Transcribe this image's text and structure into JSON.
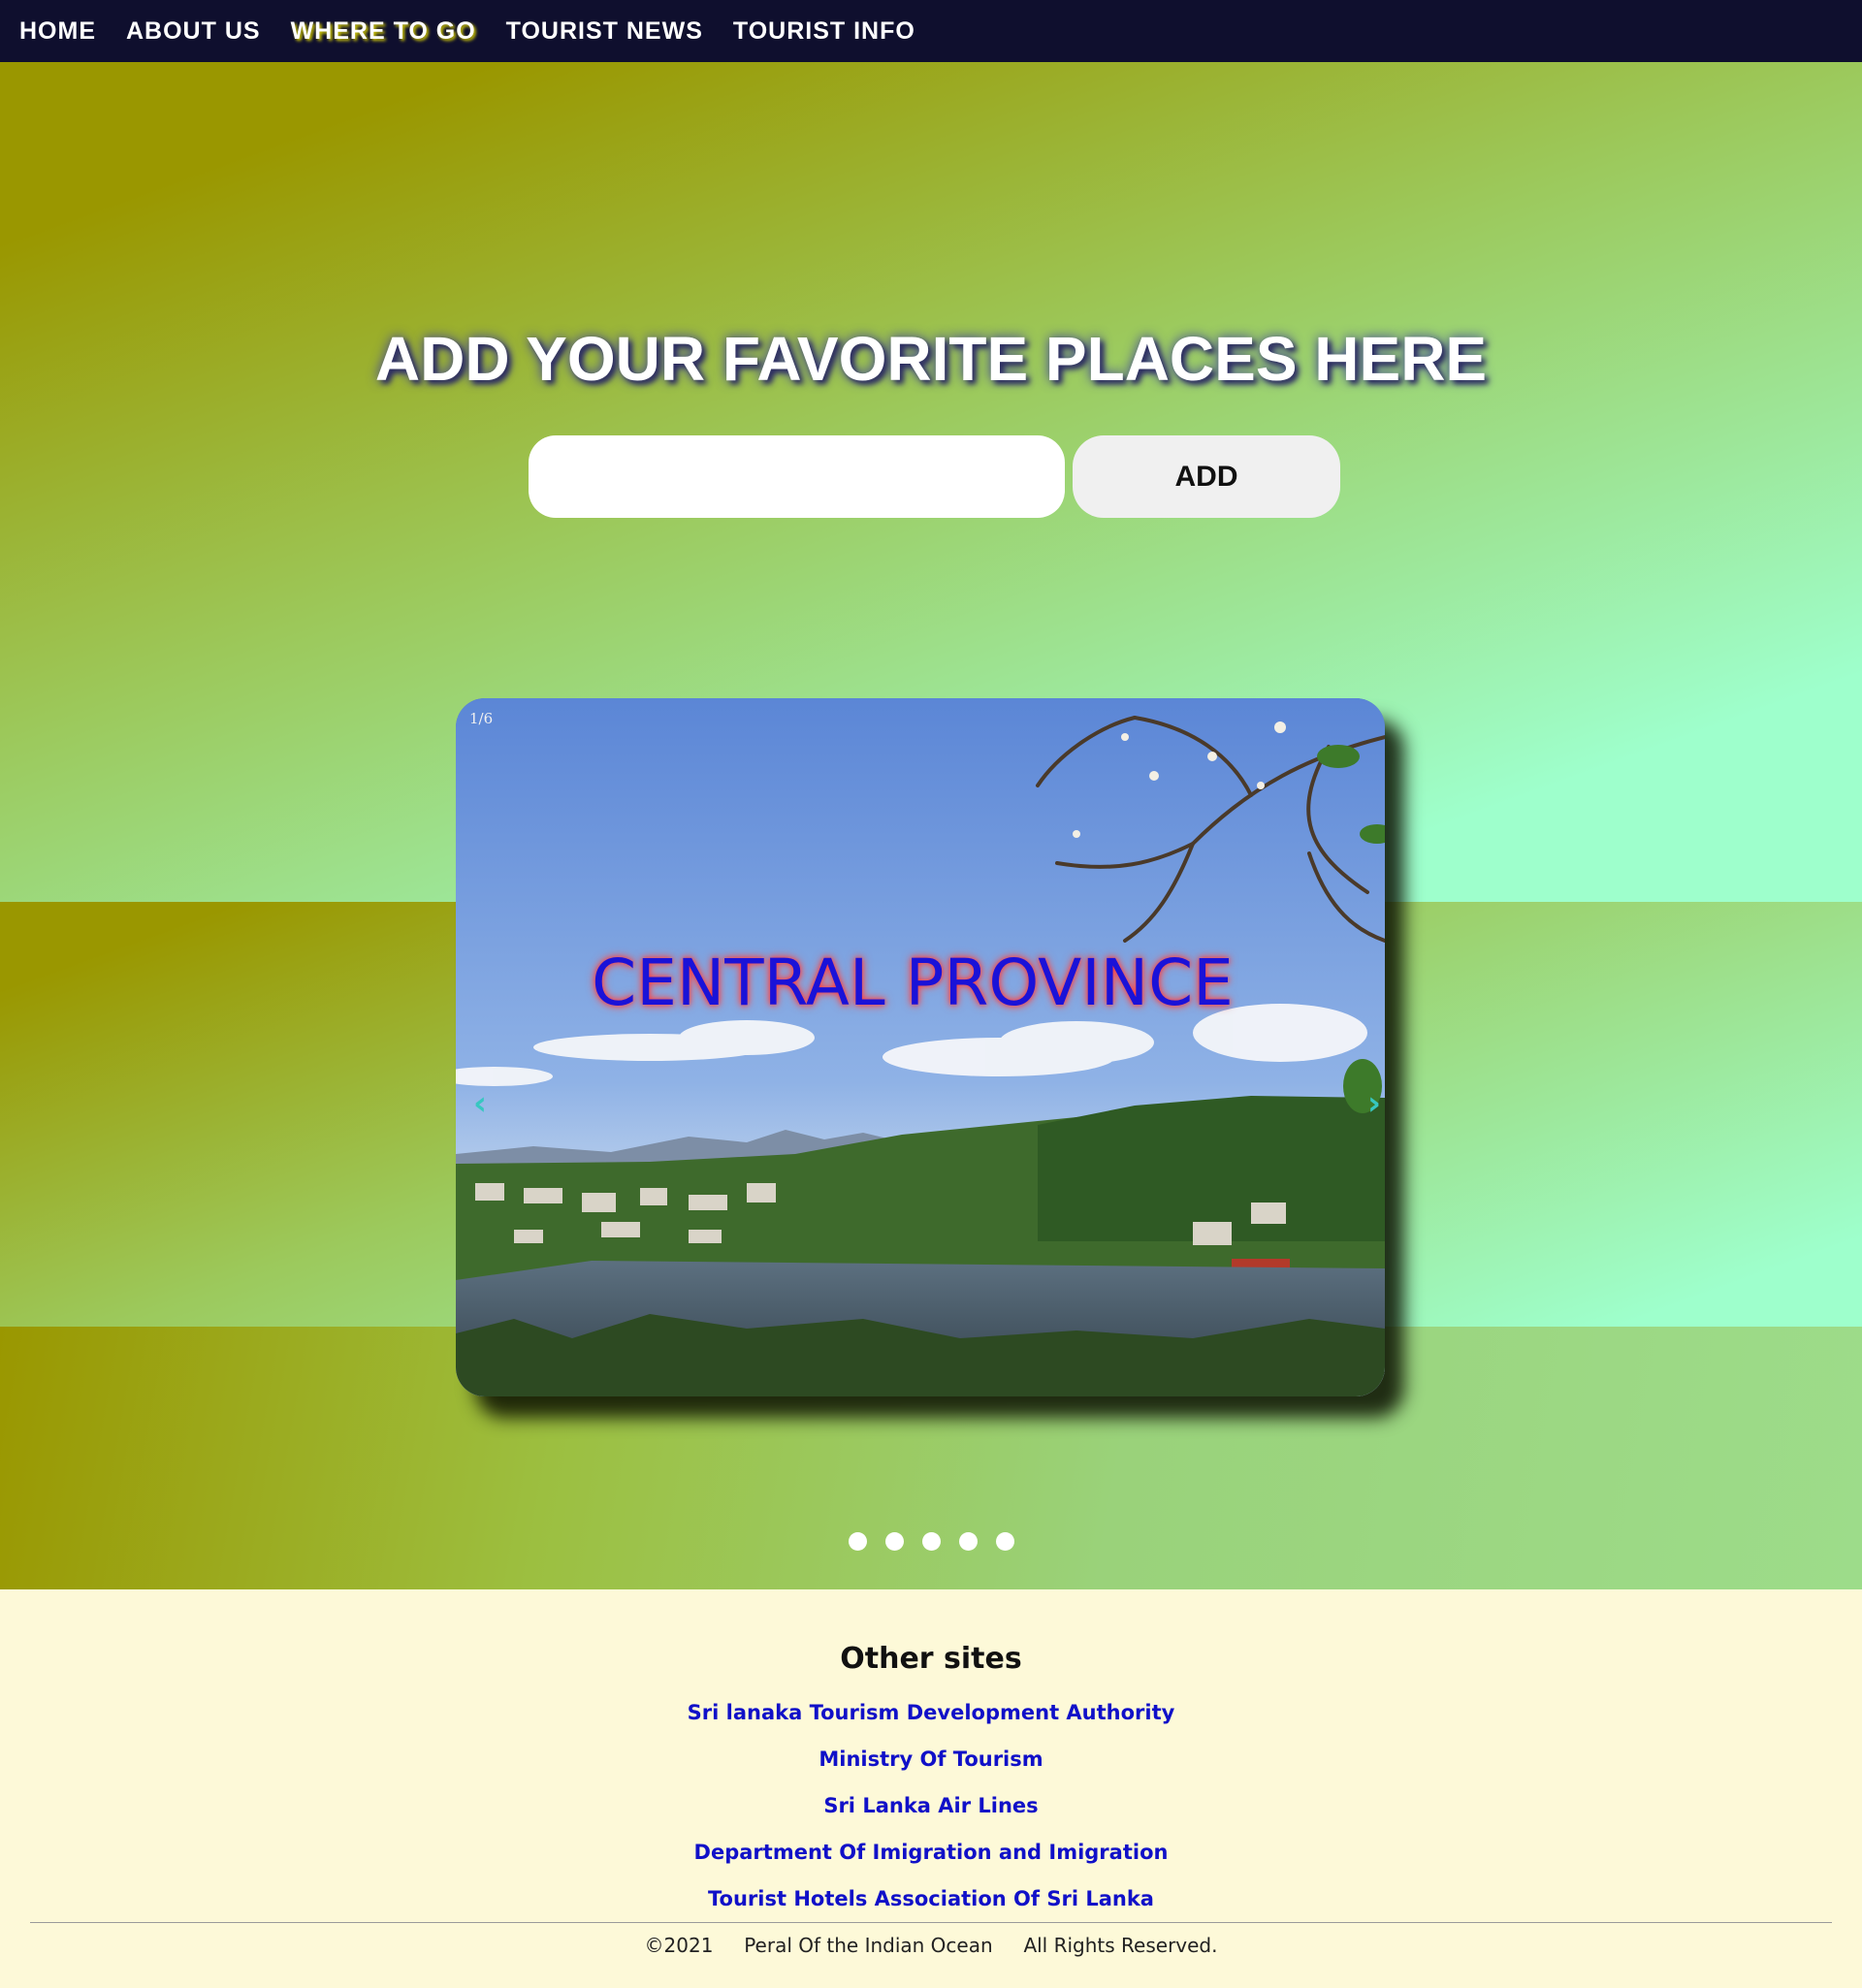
{
  "nav": {
    "items": [
      {
        "label": "HOME"
      },
      {
        "label": "ABOUT US"
      },
      {
        "label": "WHERE TO GO"
      },
      {
        "label": "TOURIST NEWS"
      },
      {
        "label": "TOURIST INFO"
      }
    ],
    "active": "WHERE TO GO"
  },
  "hero": {
    "title": "ADD YOUR FAVORITE PLACES HERE",
    "input_value": "",
    "add_label": "ADD"
  },
  "slideshow": {
    "counter": "1/6",
    "caption": "CENTRAL PROVINCE",
    "prev_symbol": "‹",
    "next_symbol": "›",
    "dot_count": 5
  },
  "footer": {
    "title": "Other sites",
    "links": [
      {
        "label": "Sri lanaka Tourism Development Authority"
      },
      {
        "label": "Ministry Of Tourism"
      },
      {
        "label": "Sri Lanka Air Lines"
      },
      {
        "label": "Department Of Imigration and Imigration"
      },
      {
        "label": "Tourist Hotels Association Of Sri Lanka"
      }
    ],
    "copyright": "©2021     Peral Of the Indian Ocean     All Rights Reserved."
  },
  "colors": {
    "nav_bg": "#0f0f2e",
    "caption": "#1a12d8",
    "link": "#1010c8",
    "footer_bg": "#fdf9d8"
  }
}
